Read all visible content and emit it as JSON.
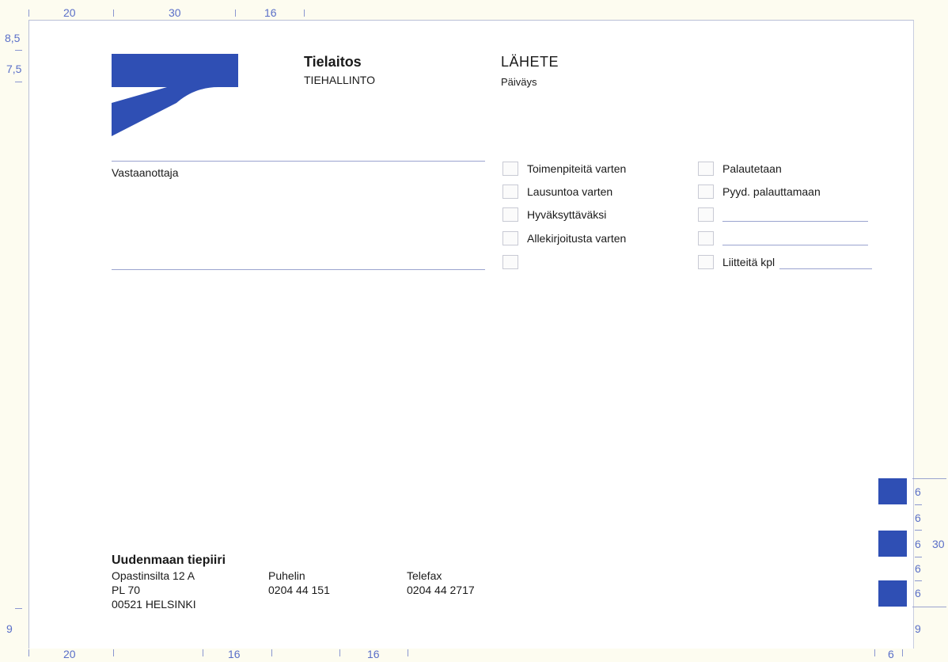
{
  "margins": {
    "top": [
      "20",
      "30",
      "16"
    ],
    "bottom": [
      "20",
      "16",
      "16",
      "6"
    ],
    "left_top": [
      "8,5",
      "7,5"
    ],
    "left_bottom": "9",
    "right": [
      "6",
      "6",
      "6",
      "6",
      "6",
      "9"
    ],
    "right_total": "30"
  },
  "header": {
    "organization": "Tielaitos",
    "department": "TIEHALLINTO",
    "document_title": "LÄHETE",
    "date_label": "Päiväys"
  },
  "recipient": {
    "label": "Vastaanottaja"
  },
  "checkboxes_left": [
    "Toimenpiteitä varten",
    "Lausuntoa varten",
    "Hyväksyttäväksi",
    "Allekirjoitusta varten",
    ""
  ],
  "checkboxes_right": [
    "Palautetaan",
    "Pyyd. palauttamaan",
    "",
    "",
    "Liitteitä kpl"
  ],
  "footer": {
    "district": "Uudenmaan tiepiiri",
    "address": [
      "Opastinsilta 12 A",
      "PL 70",
      "00521 HELSINKI"
    ],
    "phone_label": "Puhelin",
    "phone": "0204 44 151",
    "fax_label": "Telefax",
    "fax": "0204 44 2717"
  },
  "colors": {
    "brand_blue": "#2f4fb4",
    "dimension_blue": "#5a6fc8"
  }
}
